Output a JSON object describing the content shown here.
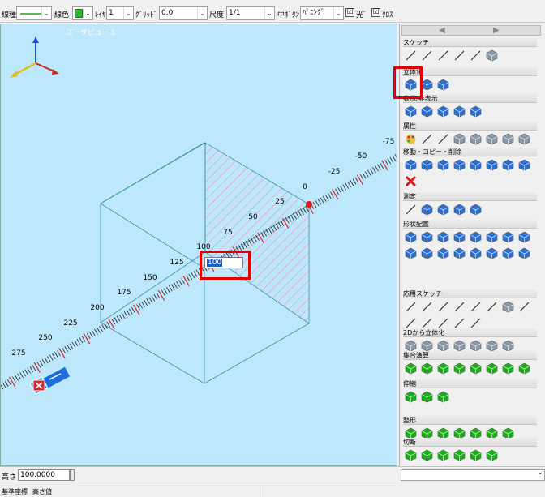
{
  "toolbar": {
    "line_type_label": "線種",
    "line_color_label": "線色",
    "line_color": "#22c022",
    "layer_label": "ﾚｲﾔ",
    "layer_value": "1",
    "grid_label": "ｸﾞﾘｯﾄﾞ",
    "grid_value": "0.0",
    "scale_label": "尺度",
    "scale_value": "1/1",
    "middle_button_label": "中ﾎﾞﾀﾝ",
    "middle_button_value": "ﾊﾟﾆﾝｸﾞ",
    "light_label": "光ﾞ",
    "light_checked": "☑",
    "cross_label": "ｸﾛｽ",
    "cross_checked": "☑"
  },
  "viewport": {
    "title": "ユーザビュー１",
    "axis_x": "X",
    "axis_y": "Y",
    "ruler_labels": [
      "-75",
      "-50",
      "-25",
      "0",
      "25",
      "50",
      "75",
      "100",
      "125",
      "150",
      "175",
      "200",
      "225",
      "250",
      "275"
    ],
    "input_value": "100",
    "colors": {
      "background": "#bde8fb",
      "hatch": "#ff7ab0",
      "ruler_tick": "#222222",
      "ruler_major": "#e02020"
    }
  },
  "panel": {
    "nav_left": "◀",
    "nav_right": "▶",
    "sections": [
      {
        "title": "スケッチ",
        "icons": [
          "line-icon",
          "circle-icon",
          "arc-icon",
          "curve-icon",
          "spline-icon",
          "eraser-icon"
        ]
      },
      {
        "title": "立体化",
        "icons": [
          "extrude-icon",
          "revolve-icon",
          "loft-icon"
        ]
      },
      {
        "title": "表示/非表示",
        "icons": [
          "show-all-icon",
          "hide-icon",
          "show-selected-icon",
          "layer-show-icon",
          "group-show-icon"
        ]
      },
      {
        "title": "属性",
        "icons": [
          "color-palette-icon",
          "line-width-icon",
          "line-style-icon",
          "transparency-icon",
          "material-icon",
          "cube-attr-icon",
          "texture-icon",
          "shade-icon"
        ]
      },
      {
        "title": "移動・コピー・削除",
        "icons": [
          "move-icon",
          "rotate-icon",
          "copy-icon",
          "mirror-icon",
          "array-icon",
          "rotate-copy-icon",
          "scale-icon",
          "redo-icon",
          "delete-icon"
        ]
      },
      {
        "title": "測定",
        "icons": [
          "measure-point-icon",
          "measure-distance-icon",
          "measure-length-icon",
          "measure-angle-icon",
          "measure-volume-icon"
        ]
      },
      {
        "title": "形状配置",
        "icons": [
          "box-shape-icon",
          "cylinder-shape-icon",
          "wedge-shape-icon",
          "cone-shape-icon",
          "torus-shape-icon",
          "sphere-shape-icon",
          "ball-shape-icon",
          "egg-shape-icon",
          "hole-shape-icon",
          "gear-shape-icon",
          "pipe-shape-icon",
          "bolt-shape-icon",
          "nut-shape-icon",
          "spring-shape-icon",
          "washer-shape-icon",
          "ring-shape-icon"
        ]
      },
      {
        "title": "応用スケッチ",
        "icons": [
          "polyline-icon",
          "offset-icon",
          "fillet-icon",
          "rectangle-icon",
          "polygon-icon",
          "trim-icon",
          "circle-sketch-icon",
          "point-icon",
          "hatch-icon",
          "chamfer-icon",
          "split-icon",
          "trim2-icon",
          "extend-icon"
        ]
      },
      {
        "title": "2Dから立体化",
        "icons": [
          "extrude-2d-icon",
          "revolve-2d-icon",
          "sweep-2d-icon",
          "loft-2d-icon",
          "pyramid-2d-icon",
          "cone-2d-icon",
          "spiral-2d-icon"
        ]
      },
      {
        "title": "集合演算",
        "icons": [
          "union-icon",
          "subtract-icon",
          "intersect-icon",
          "split-solid-icon",
          "merge-icon",
          "combine-icon",
          "cut-icon",
          "separate-icon"
        ]
      },
      {
        "title": "伸縮",
        "icons": [
          "stretch-icon",
          "stretch-face-icon",
          "stretch-axis-icon"
        ]
      },
      {
        "title": "整形",
        "icons": [
          "fillet-solid-icon",
          "chamfer-solid-icon",
          "shell-icon",
          "draft-icon",
          "thicken-icon",
          "smooth-icon",
          "repair-icon"
        ]
      },
      {
        "title": "切断",
        "icons": [
          "section-icon",
          "slice-icon",
          "split-plane-icon",
          "cut-plane-icon",
          "clip-icon",
          "cap-icon"
        ]
      }
    ]
  },
  "bottom": {
    "height_label": "高さ",
    "height_value": "100.0000",
    "status_left": "基準座標",
    "status_right": "高さ値"
  }
}
